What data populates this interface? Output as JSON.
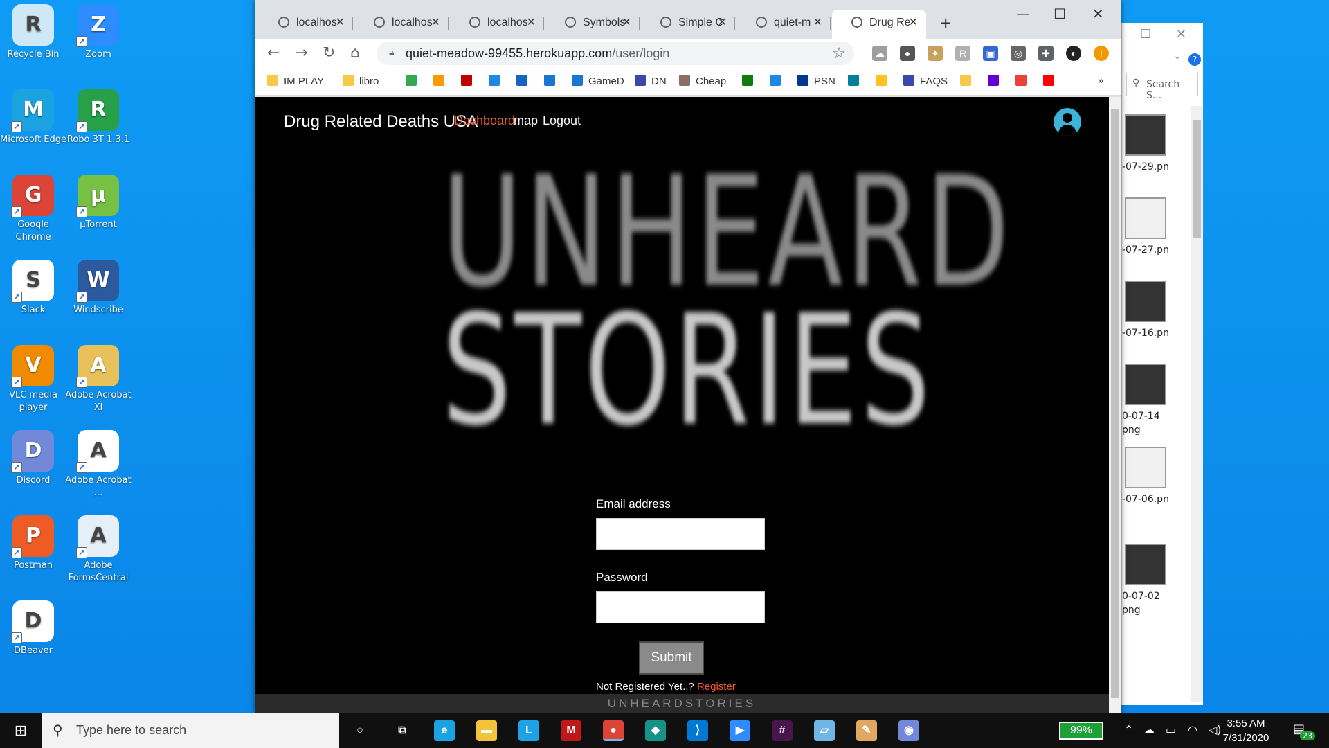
{
  "desktop": {
    "icons": [
      {
        "label": "Recycle Bin",
        "icon": "recycle-bin-icon",
        "color": "#cfe8f7"
      },
      {
        "label": "Zoom",
        "icon": "zoom-icon",
        "color": "#2d8cff"
      },
      {
        "label": "Microsoft Edge",
        "icon": "edge-icon",
        "color": "#1aa3e0"
      },
      {
        "label": "Robo 3T 1.3.1",
        "icon": "robo3t-icon",
        "color": "#27a047"
      },
      {
        "label": "Google Chrome",
        "icon": "chrome-icon",
        "color": "#db4437"
      },
      {
        "label": "µTorrent",
        "icon": "utorrent-icon",
        "color": "#76c043"
      },
      {
        "label": "Slack",
        "icon": "slack-icon",
        "color": "#ffffff"
      },
      {
        "label": "Windscribe",
        "icon": "windscribe-icon",
        "color": "#2d5a9e"
      },
      {
        "label": "VLC media player",
        "icon": "vlc-icon",
        "color": "#f08a00"
      },
      {
        "label": "Adobe Acrobat XI",
        "icon": "acrobat-xi-icon",
        "color": "#e8c15a"
      },
      {
        "label": "Discord",
        "icon": "discord-icon",
        "color": "#7289da"
      },
      {
        "label": "Adobe Acrobat ...",
        "icon": "acrobat-icon",
        "color": "#ffffff"
      },
      {
        "label": "Postman",
        "icon": "postman-icon",
        "color": "#ef5b25"
      },
      {
        "label": "Adobe FormsCentral",
        "icon": "formscentral-icon",
        "color": "#e6eef7"
      },
      {
        "label": "DBeaver",
        "icon": "dbeaver-icon",
        "color": "#ffffff"
      }
    ]
  },
  "background_window": {
    "search_placeholder": "Search S...",
    "files": [
      {
        "label": "-07-29.pn",
        "theme": "dark"
      },
      {
        "label": "-07-27.pn",
        "theme": "light"
      },
      {
        "label": "-07-16.pn",
        "theme": "dark"
      },
      {
        "label": "0-07-14\npng",
        "theme": "dark"
      },
      {
        "label": "-07-06.pn",
        "theme": "light"
      },
      {
        "label": "0-07-02\npng",
        "theme": "dark"
      }
    ]
  },
  "browser": {
    "tabs": [
      {
        "label": "localhos",
        "active": false
      },
      {
        "label": "localhos",
        "active": false
      },
      {
        "label": "localhos",
        "active": false
      },
      {
        "label": "Symbols",
        "active": false
      },
      {
        "label": "Simple C",
        "active": false
      },
      {
        "label": "quiet-m",
        "active": false
      },
      {
        "label": "Drug Re",
        "active": true
      }
    ],
    "url_host": "quiet-meadow-99455.herokuapp.com",
    "url_path": "/user/login",
    "bookmarks": [
      {
        "label": "IM PLAY",
        "color": "#f7c948"
      },
      {
        "label": "libro",
        "color": "#f7c948"
      },
      {
        "label": "",
        "color": "#34a853"
      },
      {
        "label": "",
        "color": "#ff9900"
      },
      {
        "label": "",
        "color": "#c00000"
      },
      {
        "label": "",
        "color": "#1e88e5"
      },
      {
        "label": "",
        "color": "#1565c0"
      },
      {
        "label": "",
        "color": "#1976d2"
      },
      {
        "label": "GameD",
        "color": "#1976d2"
      },
      {
        "label": "DN",
        "color": "#3949ab"
      },
      {
        "label": "Cheap",
        "color": "#8d6e63"
      },
      {
        "label": "",
        "color": "#107c10"
      },
      {
        "label": "",
        "color": "#1e88e5"
      },
      {
        "label": "PSN",
        "color": "#003791"
      },
      {
        "label": "",
        "color": "#00809d"
      },
      {
        "label": "",
        "color": "#ffc220"
      },
      {
        "label": "FAQS",
        "color": "#3949ab"
      },
      {
        "label": "",
        "color": "#f7c948"
      },
      {
        "label": "",
        "color": "#6001d2"
      },
      {
        "label": "",
        "color": "#ea4335"
      },
      {
        "label": "",
        "color": "#ff0000"
      }
    ],
    "more_bookmarks": "»"
  },
  "page": {
    "brand": "Drug Related Deaths USA",
    "nav": [
      {
        "label": "Dashboard",
        "active": true
      },
      {
        "label": "map",
        "active": false
      },
      {
        "label": "Logout",
        "active": false
      }
    ],
    "hero_line1": "UNHEARD",
    "hero_line2": "STORIES",
    "form": {
      "email_label": "Email address",
      "email_value": "",
      "password_label": "Password",
      "password_value": "",
      "submit_label": "Submit",
      "not_registered": "Not Registered Yet..?",
      "register_link": "Register"
    },
    "footer": "UNHEARDSTORIES",
    "accent_color": "#f05a28"
  },
  "taskbar": {
    "search_placeholder": "Type here to search",
    "apps": [
      {
        "name": "cortana-icon",
        "glyph": "○",
        "color": "transparent"
      },
      {
        "name": "task-view-icon",
        "glyph": "⧉",
        "color": "transparent"
      },
      {
        "name": "edge-taskbar-icon",
        "glyph": "e",
        "color": "#1aa3e0"
      },
      {
        "name": "file-explorer-icon",
        "glyph": "▬",
        "color": "#f3c33b"
      },
      {
        "name": "l-app-icon",
        "glyph": "L",
        "color": "#1fa1e6"
      },
      {
        "name": "mcafee-icon",
        "glyph": "M",
        "color": "#c01818"
      },
      {
        "name": "chrome-taskbar-icon",
        "glyph": "●",
        "color": "#db4437"
      },
      {
        "name": "gitkraken-icon",
        "glyph": "◆",
        "color": "#179287"
      },
      {
        "name": "vscode-icon",
        "glyph": "⟩",
        "color": "#0078d4"
      },
      {
        "name": "zoom-taskbar-icon",
        "glyph": "▶",
        "color": "#2d8cff"
      },
      {
        "name": "slack-taskbar-icon",
        "glyph": "#",
        "color": "#4a154b"
      },
      {
        "name": "notepad-icon",
        "glyph": "▱",
        "color": "#6fb6e6"
      },
      {
        "name": "paint-icon",
        "glyph": "✎",
        "color": "#e0a860"
      },
      {
        "name": "discord-taskbar-icon",
        "glyph": "◉",
        "color": "#7289da"
      }
    ],
    "battery": "99%",
    "time": "3:55 AM",
    "date": "7/31/2020",
    "notifications": "23"
  }
}
